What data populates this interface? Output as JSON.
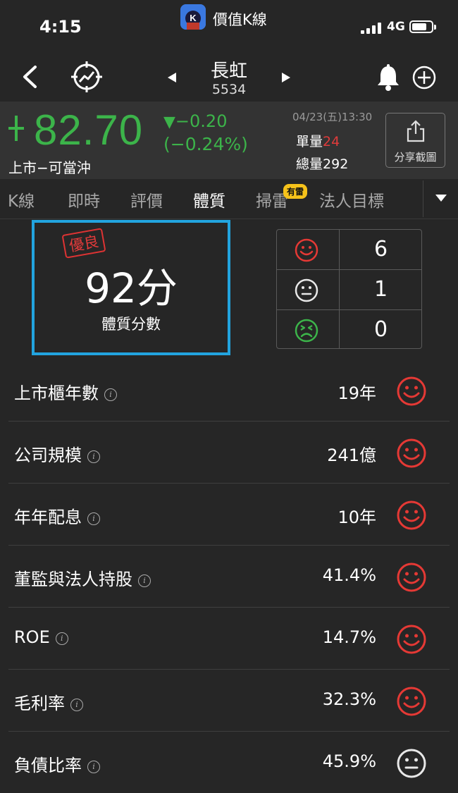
{
  "status_bar": {
    "time": "4:15",
    "app_name": "價值K線",
    "app_icon_letter": "K",
    "network": "4G"
  },
  "nav": {
    "back_icon": "back-arrow-icon",
    "target_icon": "target-icon",
    "bell_icon": "bell-icon",
    "add_icon": "plus-circle-icon"
  },
  "stock": {
    "name": "長虹",
    "code": "5534"
  },
  "quote": {
    "price": "82.70",
    "change": "−0.20",
    "change_pct": "(−0.24%)",
    "market": "上市−可當沖",
    "datetime": "04/23(五)13:30",
    "unit_volume_label": "單量",
    "unit_volume": "24",
    "total_volume_label": "總量",
    "total_volume": "292",
    "share_label": "分享截圖",
    "down_color": "#3cb44a",
    "up_color": "#e03b3b"
  },
  "tabs": [
    {
      "label": "K線"
    },
    {
      "label": "即時"
    },
    {
      "label": "評價"
    },
    {
      "label": "體質"
    },
    {
      "label": "掃雷"
    },
    {
      "label": "法人目標"
    }
  ],
  "tab_badge": "有雷",
  "score": {
    "grade": "優良",
    "value": "92分",
    "label": "體質分數"
  },
  "summary": [
    {
      "face": "happy",
      "count": "6"
    },
    {
      "face": "neutral",
      "count": "1"
    },
    {
      "face": "sad",
      "count": "0"
    }
  ],
  "rows": [
    {
      "label": "上市櫃年數",
      "value": "19年",
      "face": "happy"
    },
    {
      "label": "公司規模",
      "value": "241億",
      "face": "happy"
    },
    {
      "label": "年年配息",
      "value": "10年",
      "face": "happy"
    },
    {
      "label": "董監與法人持股",
      "value": "41.4%",
      "face": "happy"
    },
    {
      "label": "ROE",
      "value": "14.7%",
      "face": "happy"
    },
    {
      "label": "毛利率",
      "value": "32.3%",
      "face": "happy"
    },
    {
      "label": "負債比率",
      "value": "45.9%",
      "face": "neutral"
    }
  ]
}
